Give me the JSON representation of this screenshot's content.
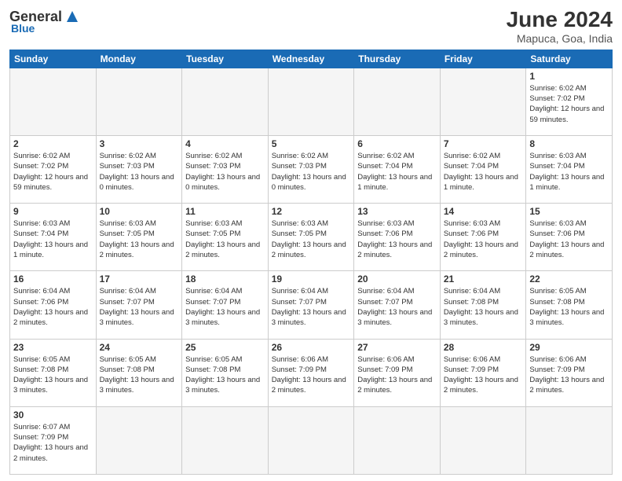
{
  "header": {
    "logo_general": "General",
    "logo_blue": "Blue",
    "title": "June 2024",
    "location": "Mapuca, Goa, India"
  },
  "days_of_week": [
    "Sunday",
    "Monday",
    "Tuesday",
    "Wednesday",
    "Thursday",
    "Friday",
    "Saturday"
  ],
  "weeks": [
    [
      {
        "day": "",
        "info": ""
      },
      {
        "day": "",
        "info": ""
      },
      {
        "day": "",
        "info": ""
      },
      {
        "day": "",
        "info": ""
      },
      {
        "day": "",
        "info": ""
      },
      {
        "day": "",
        "info": ""
      },
      {
        "day": "1",
        "info": "Sunrise: 6:02 AM\nSunset: 7:02 PM\nDaylight: 12 hours\nand 59 minutes."
      }
    ],
    [
      {
        "day": "2",
        "info": "Sunrise: 6:02 AM\nSunset: 7:02 PM\nDaylight: 12 hours\nand 59 minutes."
      },
      {
        "day": "3",
        "info": "Sunrise: 6:02 AM\nSunset: 7:03 PM\nDaylight: 13 hours\nand 0 minutes."
      },
      {
        "day": "4",
        "info": "Sunrise: 6:02 AM\nSunset: 7:03 PM\nDaylight: 13 hours\nand 0 minutes."
      },
      {
        "day": "5",
        "info": "Sunrise: 6:02 AM\nSunset: 7:03 PM\nDaylight: 13 hours\nand 0 minutes."
      },
      {
        "day": "6",
        "info": "Sunrise: 6:02 AM\nSunset: 7:04 PM\nDaylight: 13 hours\nand 1 minute."
      },
      {
        "day": "7",
        "info": "Sunrise: 6:02 AM\nSunset: 7:04 PM\nDaylight: 13 hours\nand 1 minute."
      },
      {
        "day": "8",
        "info": "Sunrise: 6:03 AM\nSunset: 7:04 PM\nDaylight: 13 hours\nand 1 minute."
      }
    ],
    [
      {
        "day": "9",
        "info": "Sunrise: 6:03 AM\nSunset: 7:04 PM\nDaylight: 13 hours\nand 1 minute."
      },
      {
        "day": "10",
        "info": "Sunrise: 6:03 AM\nSunset: 7:05 PM\nDaylight: 13 hours\nand 2 minutes."
      },
      {
        "day": "11",
        "info": "Sunrise: 6:03 AM\nSunset: 7:05 PM\nDaylight: 13 hours\nand 2 minutes."
      },
      {
        "day": "12",
        "info": "Sunrise: 6:03 AM\nSunset: 7:05 PM\nDaylight: 13 hours\nand 2 minutes."
      },
      {
        "day": "13",
        "info": "Sunrise: 6:03 AM\nSunset: 7:06 PM\nDaylight: 13 hours\nand 2 minutes."
      },
      {
        "day": "14",
        "info": "Sunrise: 6:03 AM\nSunset: 7:06 PM\nDaylight: 13 hours\nand 2 minutes."
      },
      {
        "day": "15",
        "info": "Sunrise: 6:03 AM\nSunset: 7:06 PM\nDaylight: 13 hours\nand 2 minutes."
      }
    ],
    [
      {
        "day": "16",
        "info": "Sunrise: 6:04 AM\nSunset: 7:06 PM\nDaylight: 13 hours\nand 2 minutes."
      },
      {
        "day": "17",
        "info": "Sunrise: 6:04 AM\nSunset: 7:07 PM\nDaylight: 13 hours\nand 3 minutes."
      },
      {
        "day": "18",
        "info": "Sunrise: 6:04 AM\nSunset: 7:07 PM\nDaylight: 13 hours\nand 3 minutes."
      },
      {
        "day": "19",
        "info": "Sunrise: 6:04 AM\nSunset: 7:07 PM\nDaylight: 13 hours\nand 3 minutes."
      },
      {
        "day": "20",
        "info": "Sunrise: 6:04 AM\nSunset: 7:07 PM\nDaylight: 13 hours\nand 3 minutes."
      },
      {
        "day": "21",
        "info": "Sunrise: 6:04 AM\nSunset: 7:08 PM\nDaylight: 13 hours\nand 3 minutes."
      },
      {
        "day": "22",
        "info": "Sunrise: 6:05 AM\nSunset: 7:08 PM\nDaylight: 13 hours\nand 3 minutes."
      }
    ],
    [
      {
        "day": "23",
        "info": "Sunrise: 6:05 AM\nSunset: 7:08 PM\nDaylight: 13 hours\nand 3 minutes."
      },
      {
        "day": "24",
        "info": "Sunrise: 6:05 AM\nSunset: 7:08 PM\nDaylight: 13 hours\nand 3 minutes."
      },
      {
        "day": "25",
        "info": "Sunrise: 6:05 AM\nSunset: 7:08 PM\nDaylight: 13 hours\nand 3 minutes."
      },
      {
        "day": "26",
        "info": "Sunrise: 6:06 AM\nSunset: 7:09 PM\nDaylight: 13 hours\nand 2 minutes."
      },
      {
        "day": "27",
        "info": "Sunrise: 6:06 AM\nSunset: 7:09 PM\nDaylight: 13 hours\nand 2 minutes."
      },
      {
        "day": "28",
        "info": "Sunrise: 6:06 AM\nSunset: 7:09 PM\nDaylight: 13 hours\nand 2 minutes."
      },
      {
        "day": "29",
        "info": "Sunrise: 6:06 AM\nSunset: 7:09 PM\nDaylight: 13 hours\nand 2 minutes."
      }
    ],
    [
      {
        "day": "30",
        "info": "Sunrise: 6:07 AM\nSunset: 7:09 PM\nDaylight: 13 hours\nand 2 minutes."
      },
      {
        "day": "",
        "info": ""
      },
      {
        "day": "",
        "info": ""
      },
      {
        "day": "",
        "info": ""
      },
      {
        "day": "",
        "info": ""
      },
      {
        "day": "",
        "info": ""
      },
      {
        "day": "",
        "info": ""
      }
    ]
  ]
}
